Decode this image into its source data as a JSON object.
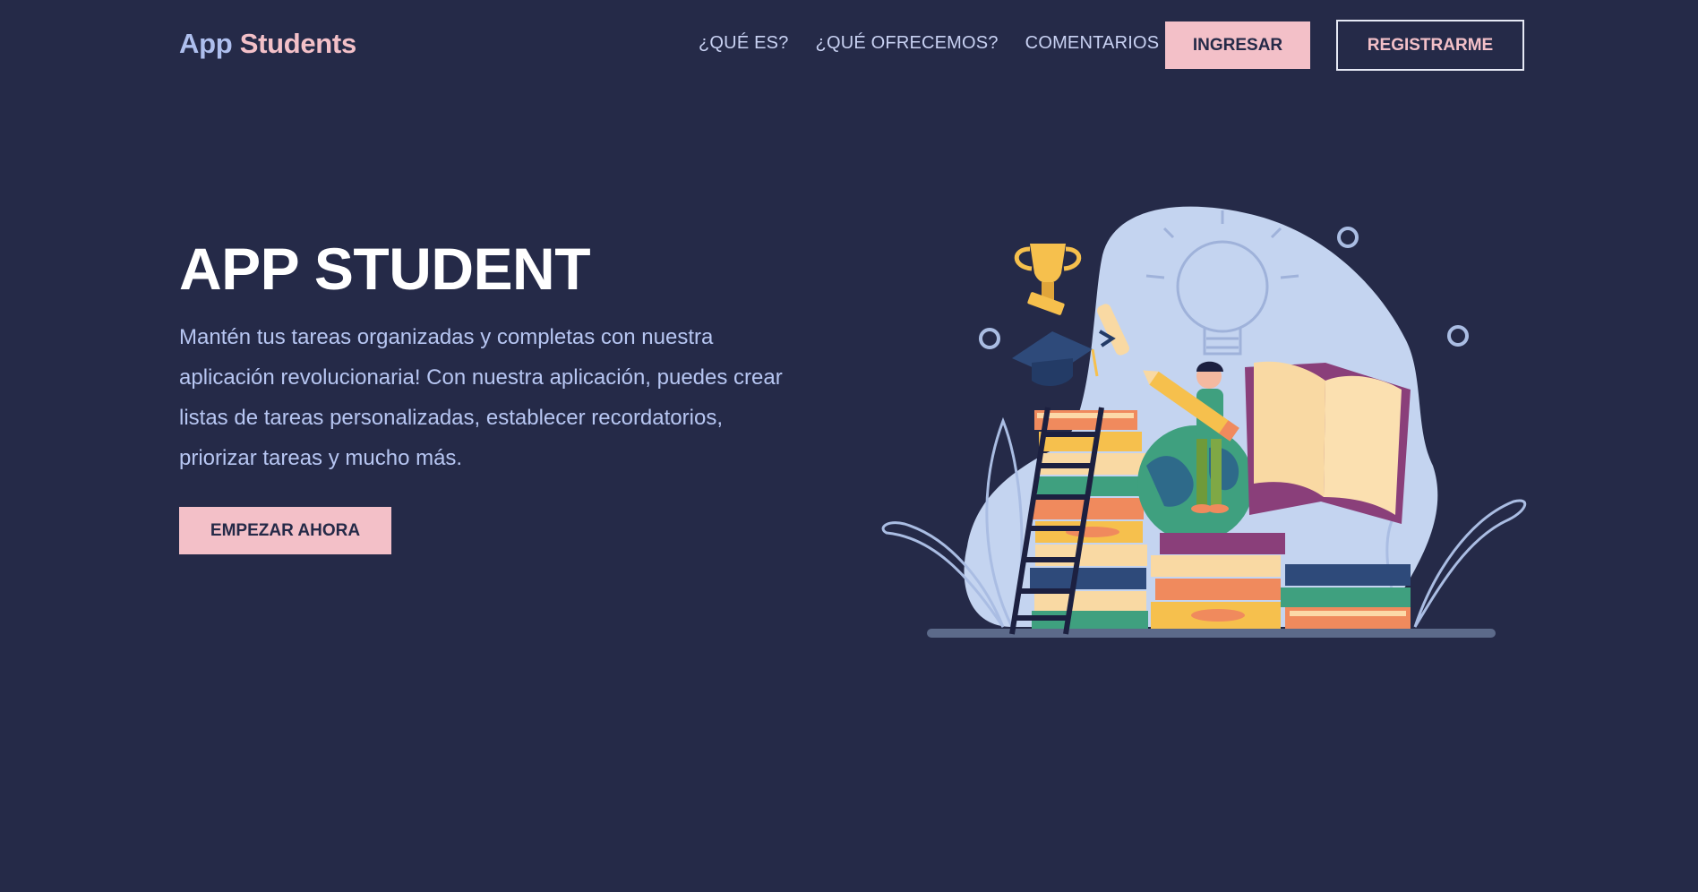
{
  "header": {
    "logo_part1": "App",
    "logo_part2": "Students",
    "nav": [
      {
        "label": "¿QUÉ ES?"
      },
      {
        "label": "¿QUÉ OFRECEMOS?"
      },
      {
        "label": "COMENTARIOS"
      }
    ],
    "login_label": "INGRESAR",
    "register_label": "REGISTRARME"
  },
  "hero": {
    "title": "APP STUDENT",
    "description": "Mantén tus tareas organizadas y completas con nuestra aplicación revolucionaria! Con nuestra aplicación, puedes crear listas de tareas personalizadas, establecer recordatorios, priorizar tareas y mucho más.",
    "cta_label": "EMPEZAR AHORA"
  },
  "illustration": {
    "subject": "student-with-books-illustration",
    "icons": [
      "trophy-icon",
      "graduation-cap-icon",
      "diploma-icon",
      "lightbulb-icon",
      "globe-icon",
      "pencil-icon",
      "ladder-icon",
      "open-book-icon"
    ]
  },
  "colors": {
    "background": "#252a48",
    "accent_pink": "#f3c0c8",
    "accent_blue": "#aebfee",
    "text_light": "#b7c6f2"
  }
}
